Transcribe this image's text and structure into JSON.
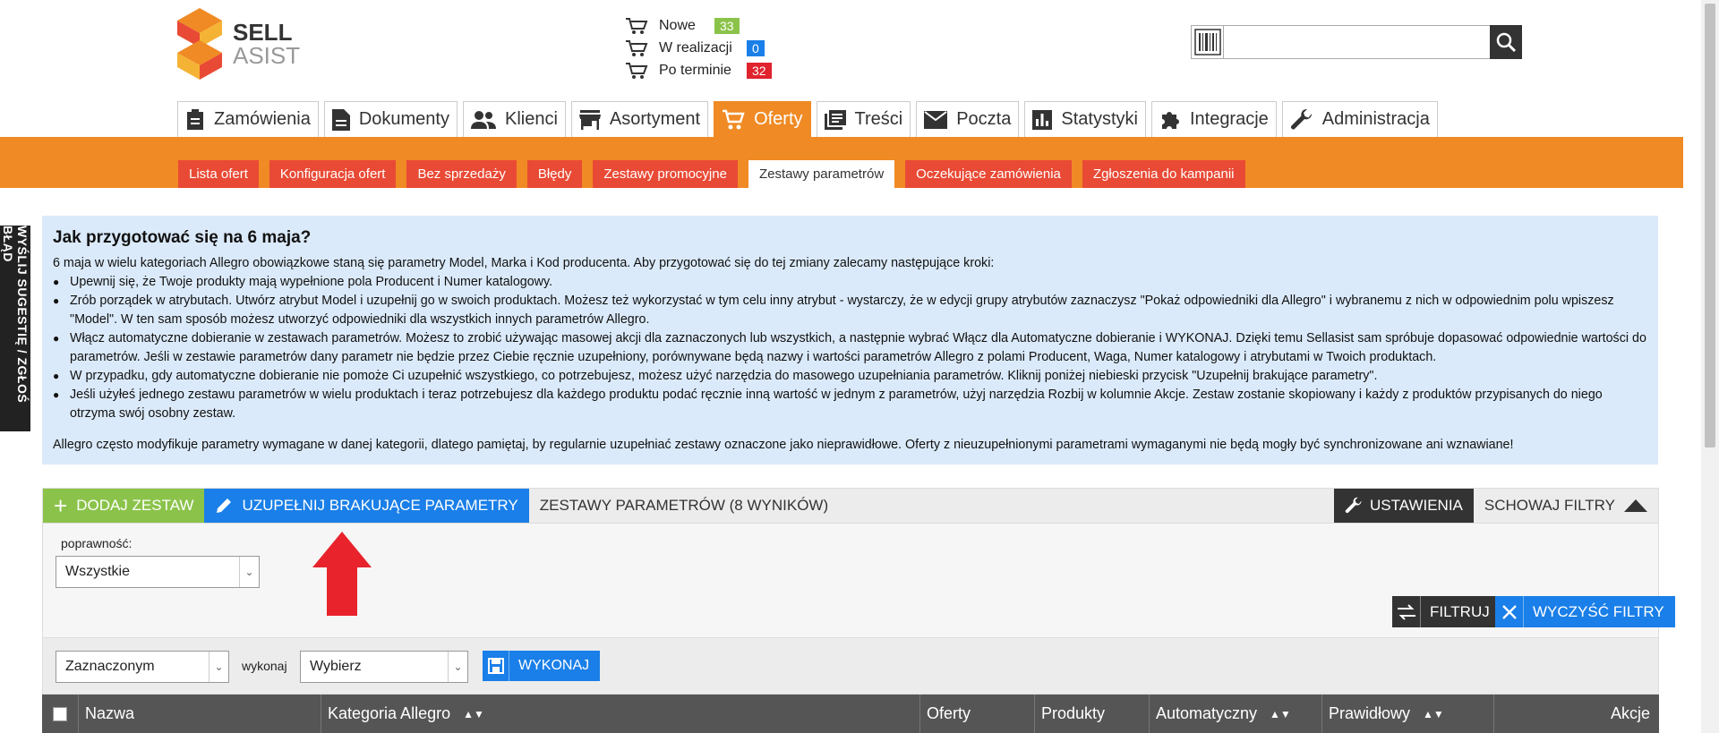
{
  "logo": {
    "line1": "SELL",
    "line2": "ASIST"
  },
  "order_summary": [
    {
      "label": "Nowe",
      "count": "33",
      "color": "#8bc34a"
    },
    {
      "label": "W realizacji",
      "count": "0",
      "color": "#1a7fe8"
    },
    {
      "label": "Po terminie",
      "count": "32",
      "color": "#e0232d"
    }
  ],
  "search": {
    "placeholder": ""
  },
  "main_nav": [
    {
      "label": "Zamówienia",
      "icon": "clipboard-icon"
    },
    {
      "label": "Dokumenty",
      "icon": "document-icon"
    },
    {
      "label": "Klienci",
      "icon": "people-icon"
    },
    {
      "label": "Asortyment",
      "icon": "store-icon"
    },
    {
      "label": "Oferty",
      "icon": "cart-icon",
      "active": true
    },
    {
      "label": "Treści",
      "icon": "content-icon"
    },
    {
      "label": "Poczta",
      "icon": "mail-icon"
    },
    {
      "label": "Statystyki",
      "icon": "stats-icon"
    },
    {
      "label": "Integracje",
      "icon": "puzzle-icon"
    },
    {
      "label": "Administracja",
      "icon": "wrench-icon"
    }
  ],
  "sub_nav": [
    {
      "label": "Lista ofert"
    },
    {
      "label": "Konfiguracja ofert"
    },
    {
      "label": "Bez sprzedaży"
    },
    {
      "label": "Błędy"
    },
    {
      "label": "Zestawy promocyjne"
    },
    {
      "label": "Zestawy parametrów",
      "active": true
    },
    {
      "label": "Oczekujące zamówienia"
    },
    {
      "label": "Zgłoszenia do kampanii"
    }
  ],
  "feedback_tab": "WYŚLIJ SUGESTIĘ / ZGŁOŚ BŁĄD",
  "info": {
    "title": "Jak przygotować się na 6 maja?",
    "intro": "6 maja w wielu kategoriach Allegro obowiązkowe staną się parametry Model, Marka i Kod producenta. Aby przygotować się do tej zmiany zalecamy następujące kroki:",
    "bullets": [
      "Upewnij się, że Twoje produkty mają wypełnione pola Producent i Numer katalogowy.",
      "Zrób porządek w atrybutach. Utwórz atrybut Model i uzupełnij go w swoich produktach. Możesz też wykorzystać w tym celu inny atrybut - wystarczy, że w edycji grupy atrybutów zaznaczysz \"Pokaż odpowiedniki dla Allegro\" i wybranemu z nich w odpowiednim polu wpiszesz \"Model\". W ten sam sposób możesz utworzyć odpowiedniki dla wszystkich innych parametrów Allegro.",
      "Włącz automatyczne dobieranie w zestawach parametrów. Możesz to zrobić używając masowej akcji dla zaznaczonych lub wszystkich, a następnie wybrać Włącz dla Automatyczne dobieranie i WYKONAJ. Dzięki temu Sellasist sam spróbuje dopasować odpowiednie wartości do parametrów. Jeśli w zestawie parametrów dany parametr nie będzie przez Ciebie ręcznie uzupełniony, porównywane będą nazwy i wartości parametrów Allegro z polami Producent, Waga, Numer katalogowy i atrybutami w Twoich produktach.",
      "W przypadku, gdy automatyczne dobieranie nie pomoże Ci uzupełnić wszystkiego, co potrzebujesz, możesz użyć narzędzia do masowego uzupełniania parametrów. Kliknij poniżej niebieski przycisk \"Uzupełnij brakujące parametry\".",
      "Jeśli użyłeś jednego zestawu parametrów w wielu produktach i teraz potrzebujesz dla każdego produktu podać ręcznie inną wartość w jednym z parametrów, użyj narzędzia Rozbij w kolumnie Akcje. Zestaw zostanie skopiowany i każdy z produktów przypisanych do niego otrzyma swój osobny zestaw."
    ],
    "footer": "Allegro często modyfikuje parametry wymagane w danej kategorii, dlatego pamiętaj, by regularnie uzupełniać zestawy oznaczone jako nieprawidłowe. Oferty z nieuzupełnionymi parametrami wymaganymi nie będą mogły być synchronizowane ani wznawiane!"
  },
  "toolbar": {
    "add_label": "DODAJ ZESTAW",
    "fill_label": "UZUPEŁNIJ BRAKUJĄCE PARAMETRY",
    "title": "ZESTAWY PARAMETRÓW (8 WYNIKÓW)",
    "settings_label": "USTAWIENIA",
    "hide_filters_label": "SCHOWAJ FILTRY"
  },
  "filters": {
    "poprawnosc_label": "poprawność:",
    "poprawnosc_value": "Wszystkie",
    "filter_button": "FILTRUJ",
    "clear_button": "WYCZYŚĆ FILTRY"
  },
  "bulk_action": {
    "scope_value": "Zaznaczonym",
    "wykonaj_label": "wykonaj",
    "action_value": "Wybierz",
    "execute_button": "WYKONAJ"
  },
  "table": {
    "columns": [
      {
        "label": "Nazwa",
        "sortable": false
      },
      {
        "label": "Kategoria Allegro",
        "sortable": true
      },
      {
        "label": "Oferty",
        "sortable": false
      },
      {
        "label": "Produkty",
        "sortable": false
      },
      {
        "label": "Automatyczny",
        "sortable": true
      },
      {
        "label": "Prawidłowy",
        "sortable": true
      },
      {
        "label": "Akcje",
        "sortable": false
      }
    ]
  },
  "colors": {
    "accent_orange": "#f08a24",
    "subnav_red": "#e94a35",
    "blue": "#1a7fe8",
    "green": "#8bc34a",
    "info_bg": "#dbeafa"
  }
}
